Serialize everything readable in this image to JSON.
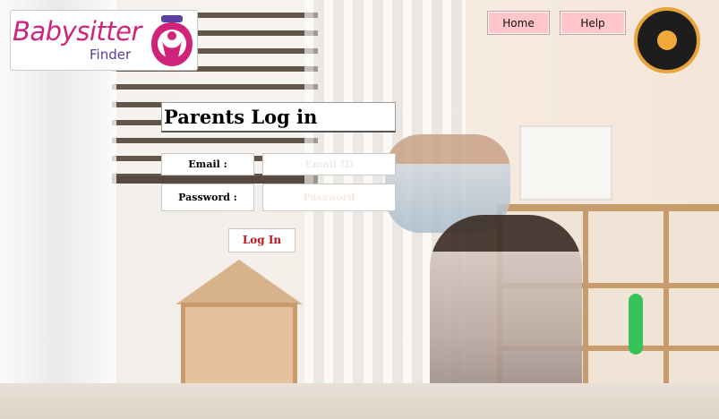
{
  "app": {
    "brand_name": "Babysitter",
    "brand_sub": "Finder",
    "brand_color": "#d2237a",
    "brand_sub_color": "#5a3fa0"
  },
  "nav": {
    "home_label": "Home",
    "help_label": "Help",
    "button_color": "#ffc5c9"
  },
  "login": {
    "title": "Parents Log in",
    "email_label": "Email :",
    "email_placeholder": "Email ID",
    "email_value": "",
    "password_label": "Password :",
    "password_placeholder": "Password",
    "password_value": "",
    "submit_label": "Log In",
    "submit_color": "#c0151b"
  },
  "icons": {
    "logo_mark": "mother-child-icon"
  }
}
